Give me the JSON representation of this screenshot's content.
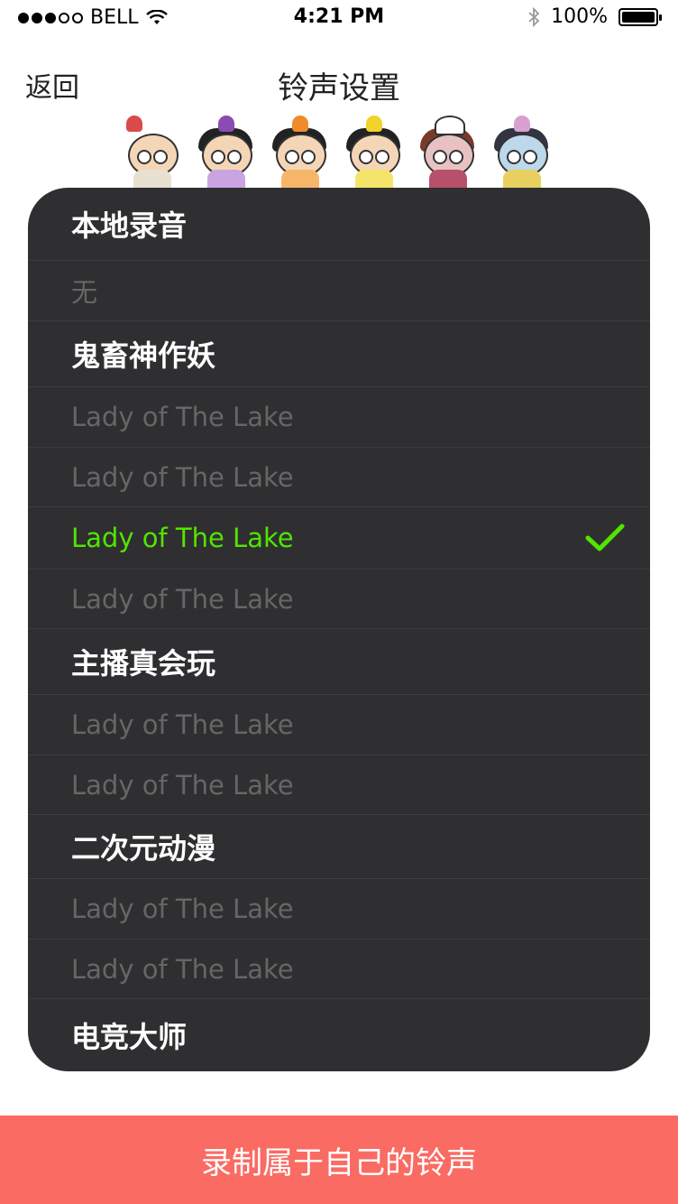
{
  "status_bar": {
    "carrier": "BELL",
    "time": "4:21 PM",
    "battery": "100%"
  },
  "nav": {
    "back_label": "返回",
    "title": "铃声设置"
  },
  "rows": [
    {
      "text": "本地录音",
      "type": "category"
    },
    {
      "text": "无",
      "type": "item"
    },
    {
      "text": "鬼畜神作妖",
      "type": "category"
    },
    {
      "text": "Lady of The Lake",
      "type": "item"
    },
    {
      "text": "Lady of The Lake",
      "type": "item"
    },
    {
      "text": "Lady of The Lake",
      "type": "item",
      "selected": true
    },
    {
      "text": "Lady of The Lake",
      "type": "item"
    },
    {
      "text": "主播真会玩",
      "type": "category"
    },
    {
      "text": "Lady of The Lake",
      "type": "item"
    },
    {
      "text": "Lady of The Lake",
      "type": "item"
    },
    {
      "text": "二次元动漫",
      "type": "category"
    },
    {
      "text": "Lady of The Lake",
      "type": "item"
    },
    {
      "text": "Lady of The Lake",
      "type": "item"
    },
    {
      "text": "电竞大师",
      "type": "category"
    }
  ],
  "record_button_label": "录制属于自己的铃声",
  "colors": {
    "panel": "#2f2f31",
    "selected": "#51e500",
    "item_text": "#666666",
    "record_button": "#fa6b63"
  }
}
